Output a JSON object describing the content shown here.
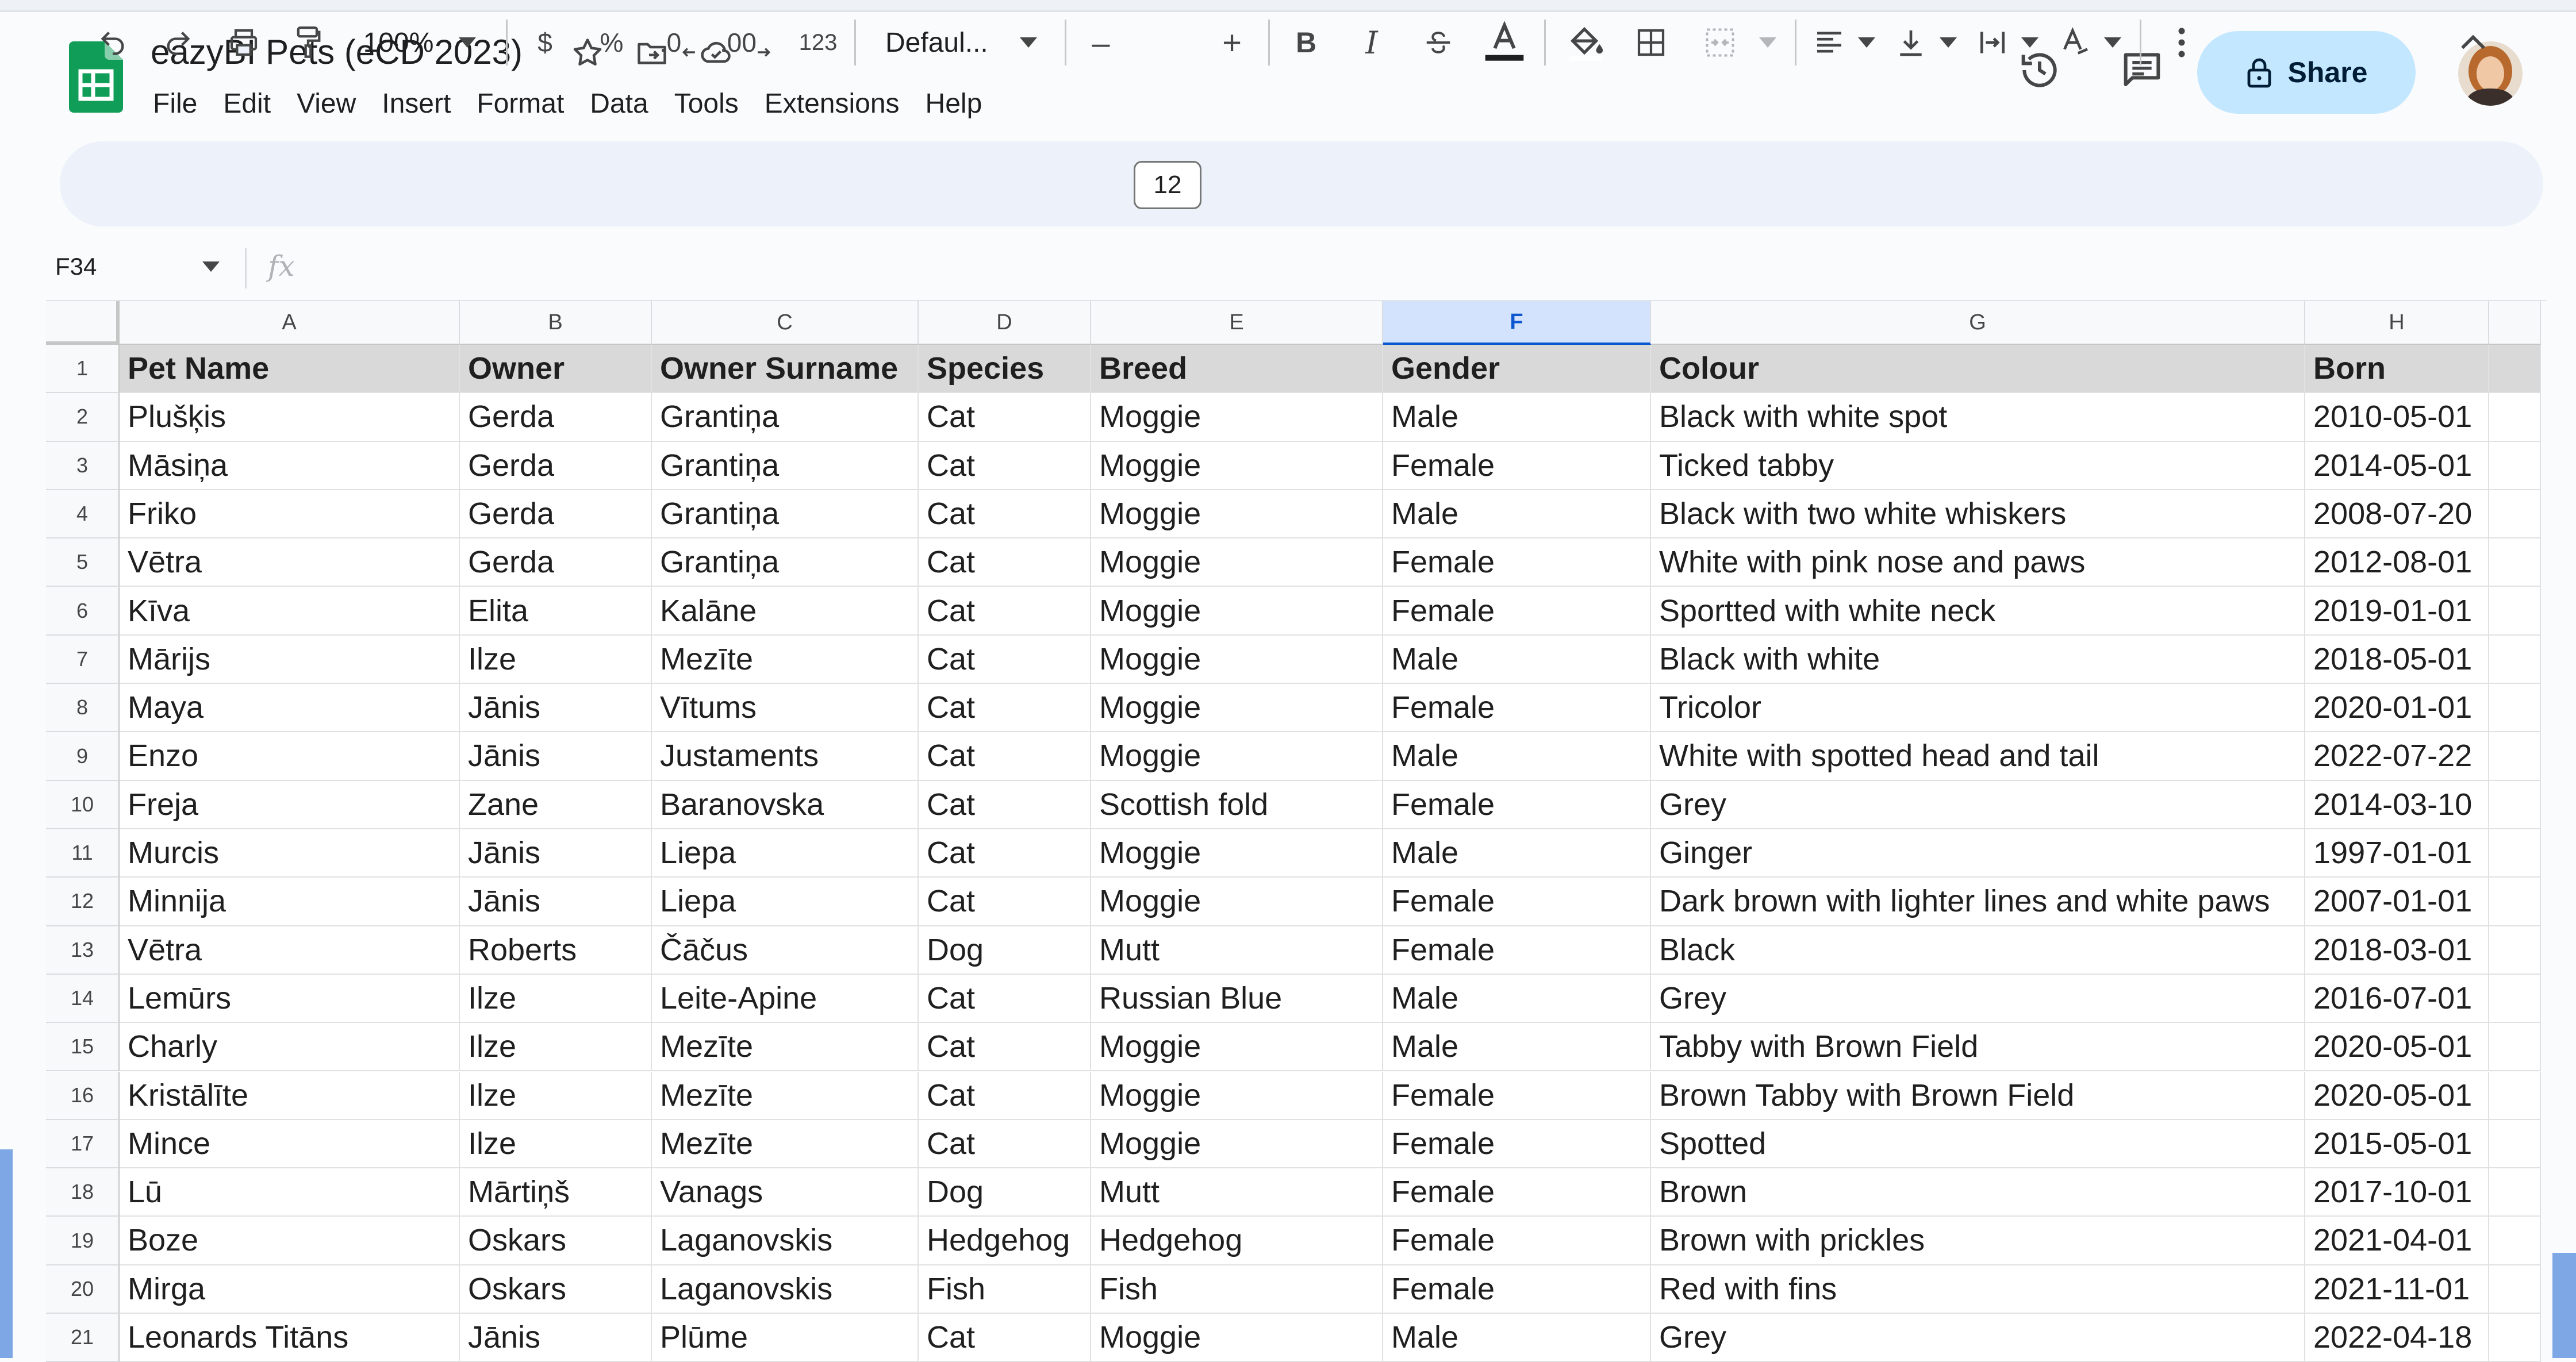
{
  "app": {
    "title": "eazyBI Pets (eCD 2023)",
    "menu": [
      "File",
      "Edit",
      "View",
      "Insert",
      "Format",
      "Data",
      "Tools",
      "Extensions",
      "Help"
    ],
    "share_label": "Share"
  },
  "toolbar": {
    "zoom": "100%",
    "currency": "$",
    "percent": "%",
    "decrease_decimal": ".0",
    "increase_decimal": ".00",
    "number_format": "123",
    "font": "Defaul...",
    "font_size": "12",
    "minus": "–",
    "plus": "+",
    "bold": "B",
    "italic": "I"
  },
  "formula_bar": {
    "cell_ref": "F34",
    "fx": "fx"
  },
  "sheet": {
    "selected_column": "F",
    "row_numbers": [
      "1",
      "2",
      "3",
      "4",
      "5",
      "6",
      "7",
      "8",
      "9",
      "10",
      "11",
      "12",
      "13",
      "14",
      "15",
      "16",
      "17",
      "18",
      "19",
      "20",
      "21"
    ],
    "columns": [
      "A",
      "B",
      "C",
      "D",
      "E",
      "F",
      "G",
      "H"
    ],
    "header": [
      "Pet Name",
      "Owner",
      "Owner Surname",
      "Species",
      "Breed",
      "Gender",
      "Colour",
      "Born"
    ],
    "rows": [
      [
        "Plušķis",
        "Gerda",
        "Grantiņa",
        "Cat",
        "Moggie",
        "Male",
        "Black with white spot",
        "2010-05-01"
      ],
      [
        "Māsiņa",
        "Gerda",
        "Grantiņa",
        "Cat",
        "Moggie",
        "Female",
        "Ticked tabby",
        "2014-05-01"
      ],
      [
        "Friko",
        "Gerda",
        "Grantiņa",
        "Cat",
        "Moggie",
        "Male",
        "Black with two white whiskers",
        "2008-07-20"
      ],
      [
        "Vētra",
        "Gerda",
        "Grantiņa",
        "Cat",
        "Moggie",
        "Female",
        "White with pink nose and paws",
        "2012-08-01"
      ],
      [
        "Kīva",
        "Elita",
        "Kalāne",
        "Cat",
        "Moggie",
        "Female",
        "Sportted with white neck",
        "2019-01-01"
      ],
      [
        "Mārijs",
        "Ilze",
        "Mezīte",
        "Cat",
        "Moggie",
        "Male",
        "Black with white",
        "2018-05-01"
      ],
      [
        "Maya",
        "Jānis",
        "Vītums",
        "Cat",
        "Moggie",
        "Female",
        "Tricolor",
        "2020-01-01"
      ],
      [
        "Enzo",
        "Jānis",
        "Justaments",
        "Cat",
        "Moggie",
        "Male",
        "White with spotted head and tail",
        "2022-07-22"
      ],
      [
        "Freja",
        "Zane",
        "Baranovska",
        "Cat",
        "Scottish fold",
        "Female",
        "Grey",
        "2014-03-10"
      ],
      [
        "Murcis",
        "Jānis",
        "Liepa",
        "Cat",
        "Moggie",
        "Male",
        "Ginger",
        "1997-01-01"
      ],
      [
        "Minnija",
        "Jānis",
        "Liepa",
        "Cat",
        "Moggie",
        "Female",
        "Dark brown with lighter lines and white paws",
        "2007-01-01"
      ],
      [
        "Vētra",
        "Roberts",
        "Čāčus",
        "Dog",
        "Mutt",
        "Female",
        "Black",
        "2018-03-01"
      ],
      [
        "Lemūrs",
        "Ilze",
        "Leite-Apine",
        "Cat",
        "Russian Blue",
        "Male",
        "Grey",
        "2016-07-01"
      ],
      [
        "Charly",
        "Ilze",
        "Mezīte",
        "Cat",
        "Moggie",
        "Male",
        "Tabby with Brown Field",
        "2020-05-01"
      ],
      [
        "Kristālīte",
        "Ilze",
        "Mezīte",
        "Cat",
        "Moggie",
        "Female",
        "Brown Tabby with Brown Field",
        "2020-05-01"
      ],
      [
        "Mince",
        "Ilze",
        "Mezīte",
        "Cat",
        "Moggie",
        "Female",
        "Spotted",
        "2015-05-01"
      ],
      [
        "Lū",
        "Mārtiņš",
        "Vanags",
        "Dog",
        "Mutt",
        "Female",
        "Brown",
        "2017-10-01"
      ],
      [
        "Boze",
        "Oskars",
        "Laganovskis",
        "Hedgehog",
        "Hedgehog",
        "Female",
        "Brown with prickles",
        "2021-04-01"
      ],
      [
        "Mirga",
        "Oskars",
        "Laganovskis",
        "Fish",
        "Fish",
        "Female",
        "Red with fins",
        "2021-11-01"
      ],
      [
        "Leonards Titāns",
        "Jānis",
        "Plūme",
        "Cat",
        "Moggie",
        "Male",
        "Grey",
        "2022-04-18"
      ]
    ]
  },
  "colors": {
    "accent": "#0b57d0",
    "share_bg": "#c2e7ff",
    "toolbar_bg": "#edf2fa",
    "header_row_bg": "#d9d9d9",
    "sheets_green": "#0f9d58"
  }
}
